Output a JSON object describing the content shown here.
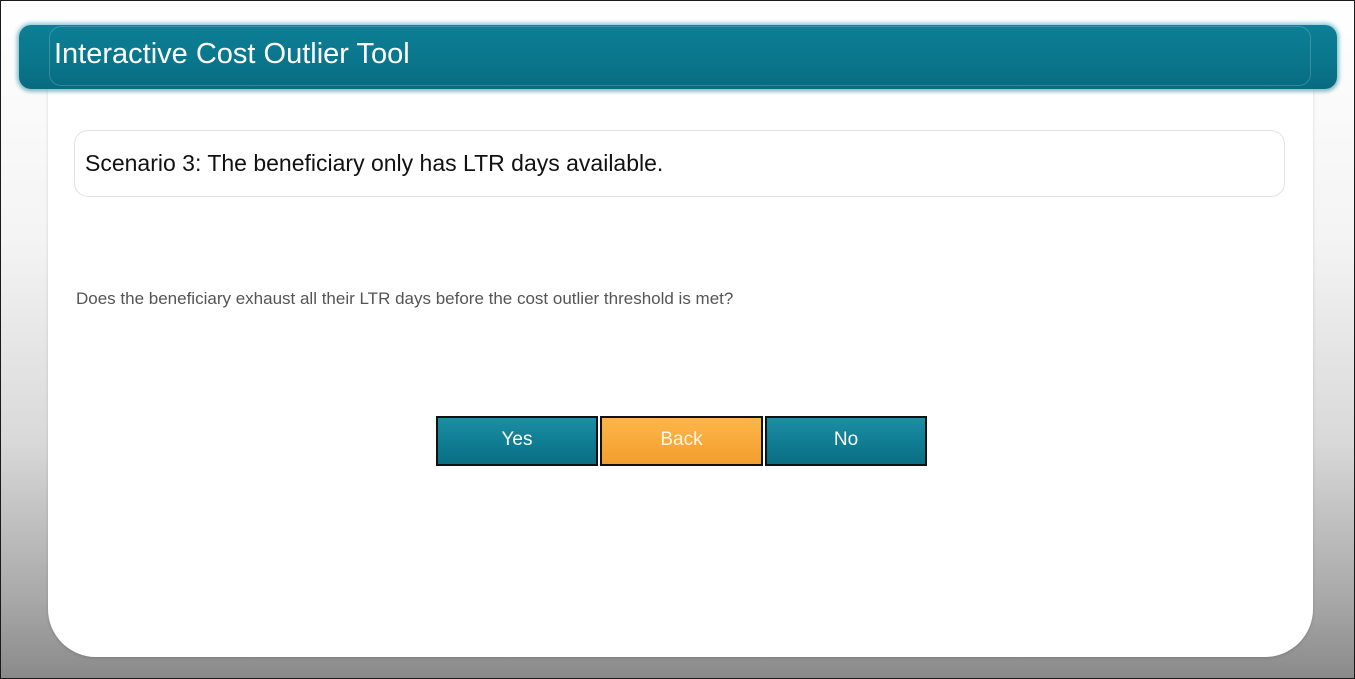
{
  "header": {
    "title": "Interactive Cost Outlier Tool"
  },
  "scenario": {
    "text": "Scenario 3: The beneficiary only has LTR days available."
  },
  "question": {
    "text": "Does the beneficiary exhaust all their LTR days before the cost outlier threshold is met?"
  },
  "buttons": {
    "yes_label": "Yes",
    "back_label": "Back",
    "no_label": "No"
  },
  "colors": {
    "header": "#0a778d",
    "button_primary": "#107e94",
    "button_back": "#f8aa3a"
  }
}
